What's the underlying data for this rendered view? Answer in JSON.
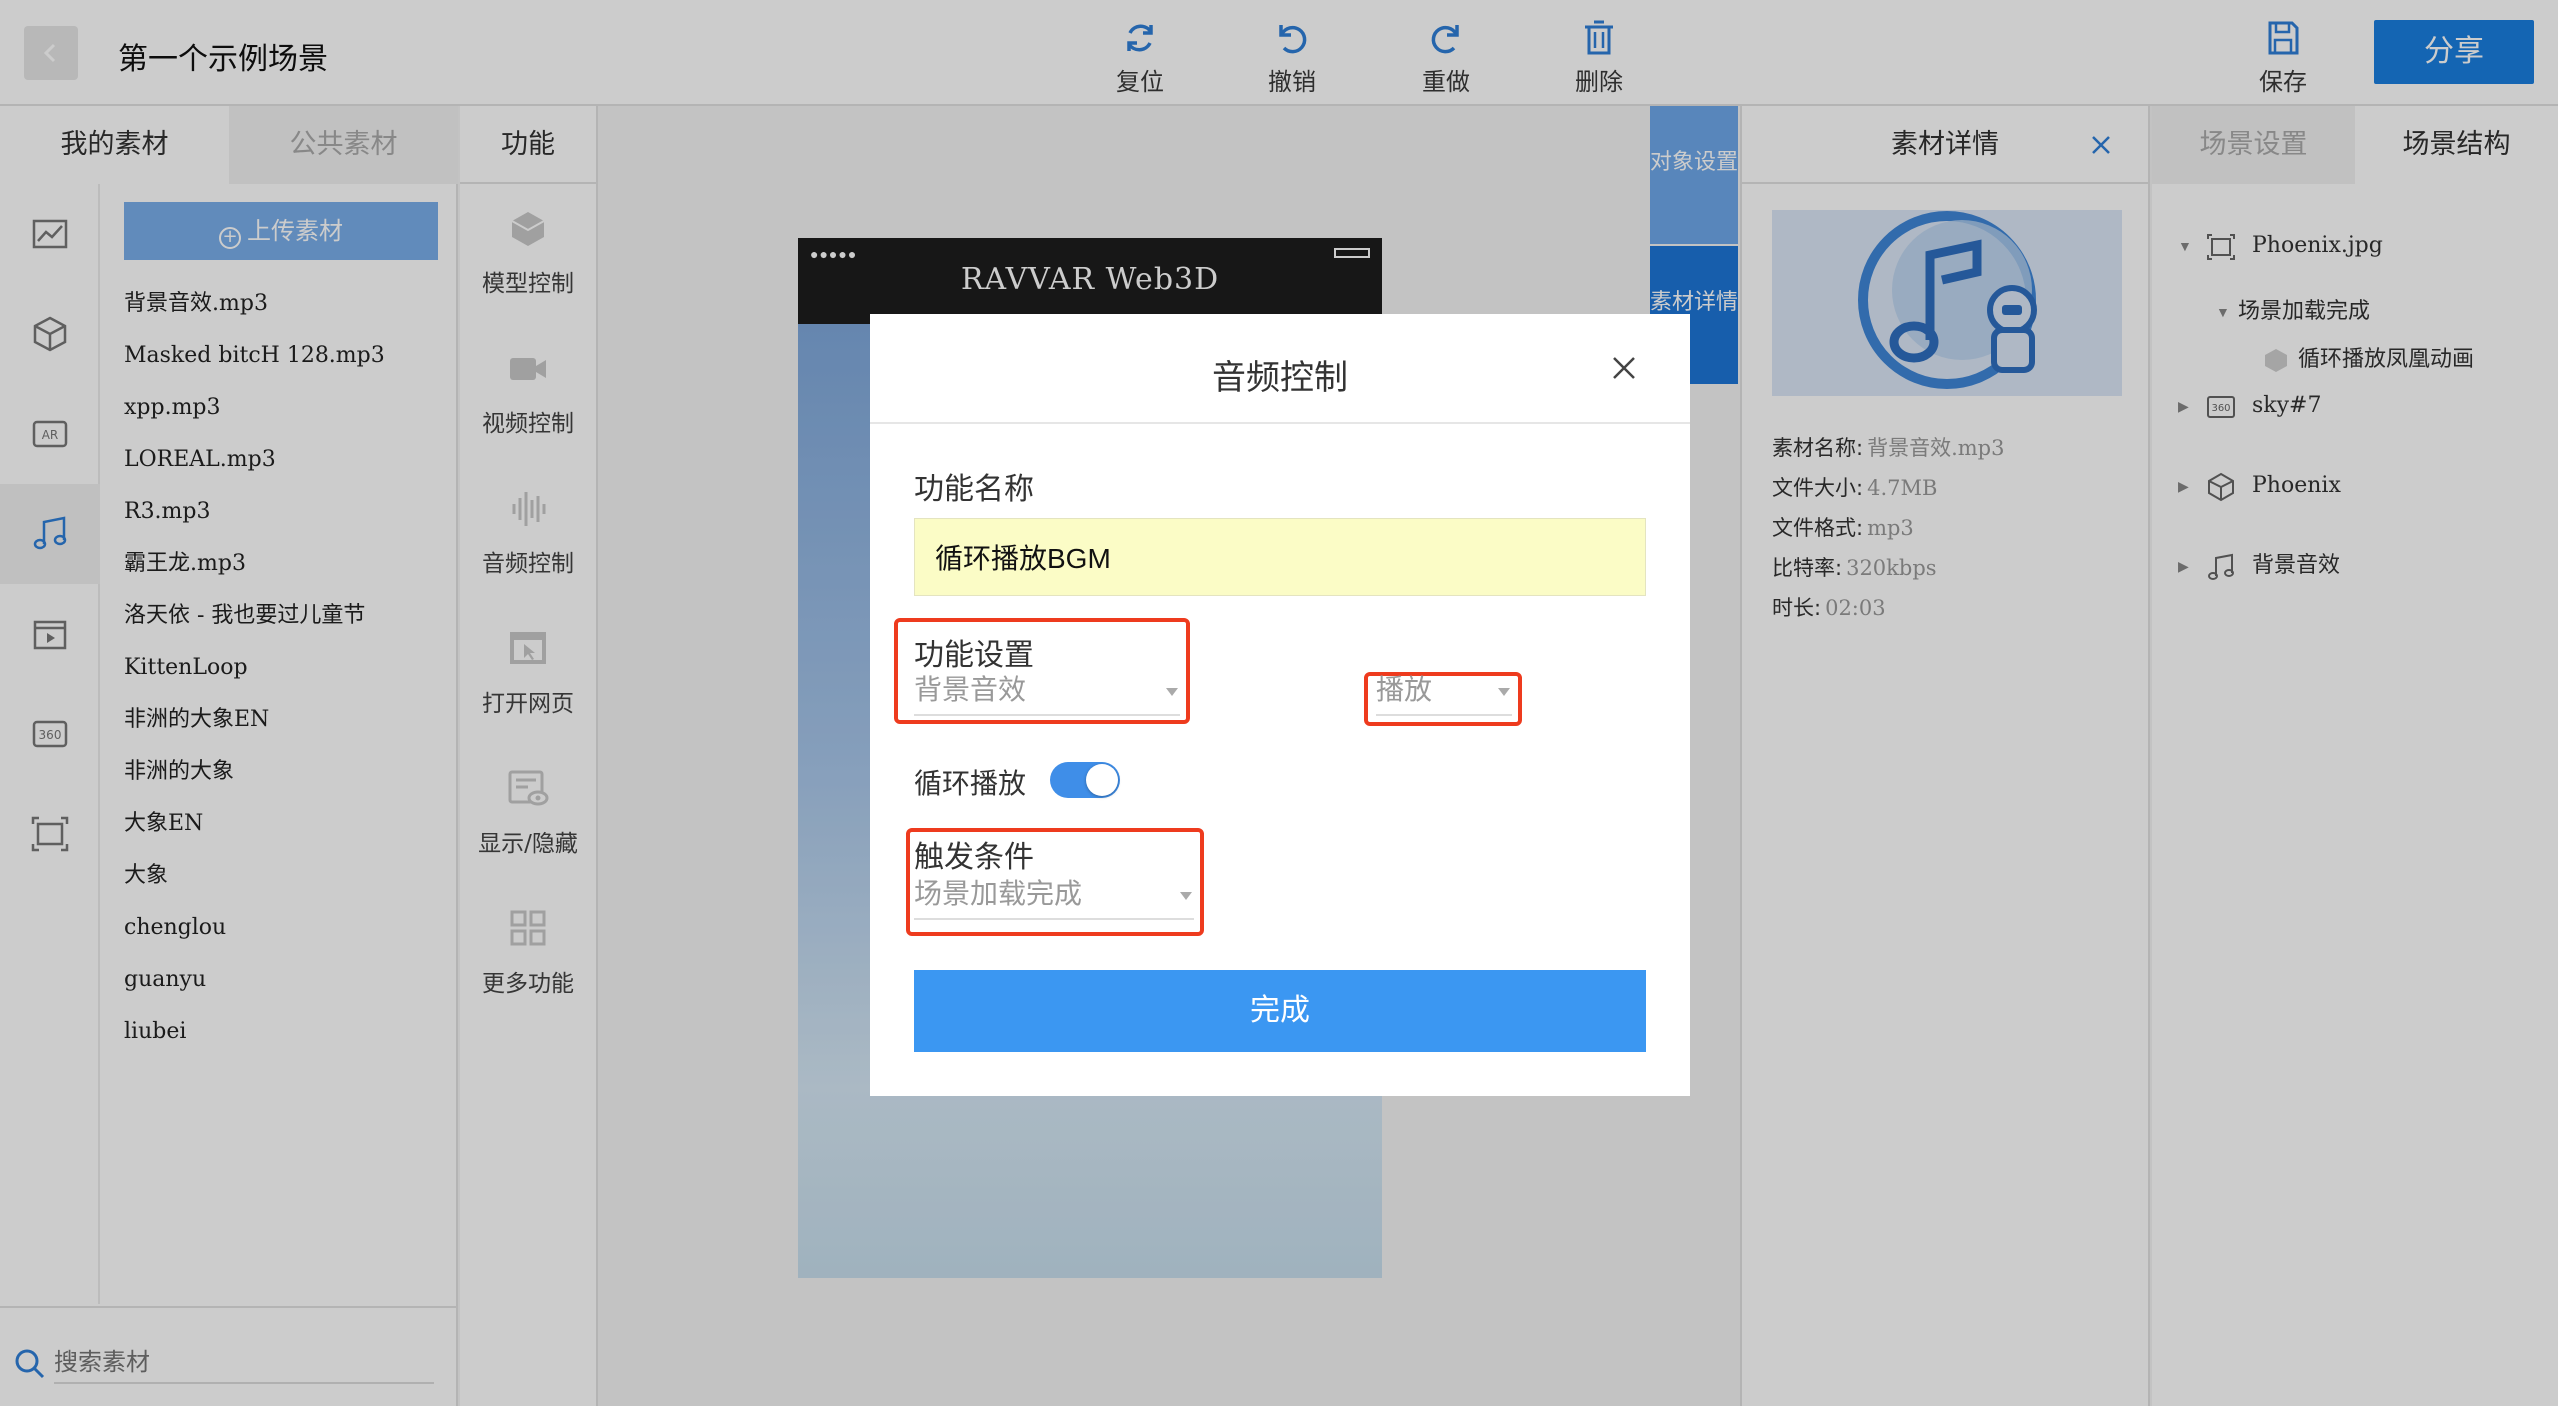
{
  "header": {
    "scene_title": "第一个示例场景",
    "tools": [
      {
        "label": "复位",
        "icon": "reset-icon"
      },
      {
        "label": "撤销",
        "icon": "undo-icon"
      },
      {
        "label": "重做",
        "icon": "redo-icon"
      },
      {
        "label": "删除",
        "icon": "trash-icon"
      }
    ],
    "save_label": "保存",
    "share_label": "分享"
  },
  "left_panel": {
    "tabs": [
      "我的素材",
      "公共素材"
    ],
    "categories": [
      "image-icon",
      "model-icon",
      "ar-icon",
      "audio-icon",
      "video-icon",
      "360-icon",
      "frame-icon"
    ],
    "upload_label": "上传素材",
    "files": [
      "背景音效.mp3",
      "Masked bitcH 128.mp3",
      "xpp.mp3",
      "LOREAL.mp3",
      "R3.mp3",
      "霸王龙.mp3",
      "洛天依 - 我也要过儿童节",
      "KittenLoop",
      "非洲的大象EN",
      "非洲的大象",
      "大象EN",
      "大象",
      "chenglou",
      "guanyu",
      "liubei"
    ],
    "search_placeholder": "搜索素材"
  },
  "function_panel": {
    "title": "功能",
    "items": [
      "模型控制",
      "视频控制",
      "音频控制",
      "打开网页",
      "显示/隐藏",
      "更多功能"
    ]
  },
  "canvas": {
    "phone_title": "RAVVAR Web3D",
    "phone_dots": "●●●●●",
    "side_tabs": [
      "对象设置",
      "素材详情"
    ]
  },
  "detail_panel": {
    "title": "素材详情",
    "meta": [
      {
        "key": "素材名称:",
        "value": "背景音效.mp3"
      },
      {
        "key": "文件大小:",
        "value": "4.7MB"
      },
      {
        "key": "文件格式:",
        "value": "mp3"
      },
      {
        "key": "比特率:",
        "value": "320kbps"
      },
      {
        "key": "时长:",
        "value": "02:03"
      }
    ]
  },
  "structure_panel": {
    "tabs": [
      "场景设置",
      "场景结构"
    ],
    "tree": [
      {
        "label": "Phoenix.jpg"
      },
      {
        "label": "场景加载完成"
      },
      {
        "label": "循环播放凤凰动画"
      },
      {
        "label": "sky#7"
      },
      {
        "label": "Phoenix"
      },
      {
        "label": "背景音效"
      }
    ]
  },
  "modal": {
    "title": "音频控制",
    "name_label": "功能名称",
    "name_value": "循环播放BGM",
    "setting_label": "功能设置",
    "setting_value": "背景音效",
    "action_value": "播放",
    "loop_label": "循环播放",
    "loop_on": true,
    "trigger_label": "触发条件",
    "trigger_value": "场景加载完成",
    "done_label": "完成"
  },
  "colors": {
    "accent": "#1a7fe0",
    "button": "#3b97f2",
    "highlight": "#ee3b1e",
    "name_input_bg": "#fbfcc6"
  }
}
